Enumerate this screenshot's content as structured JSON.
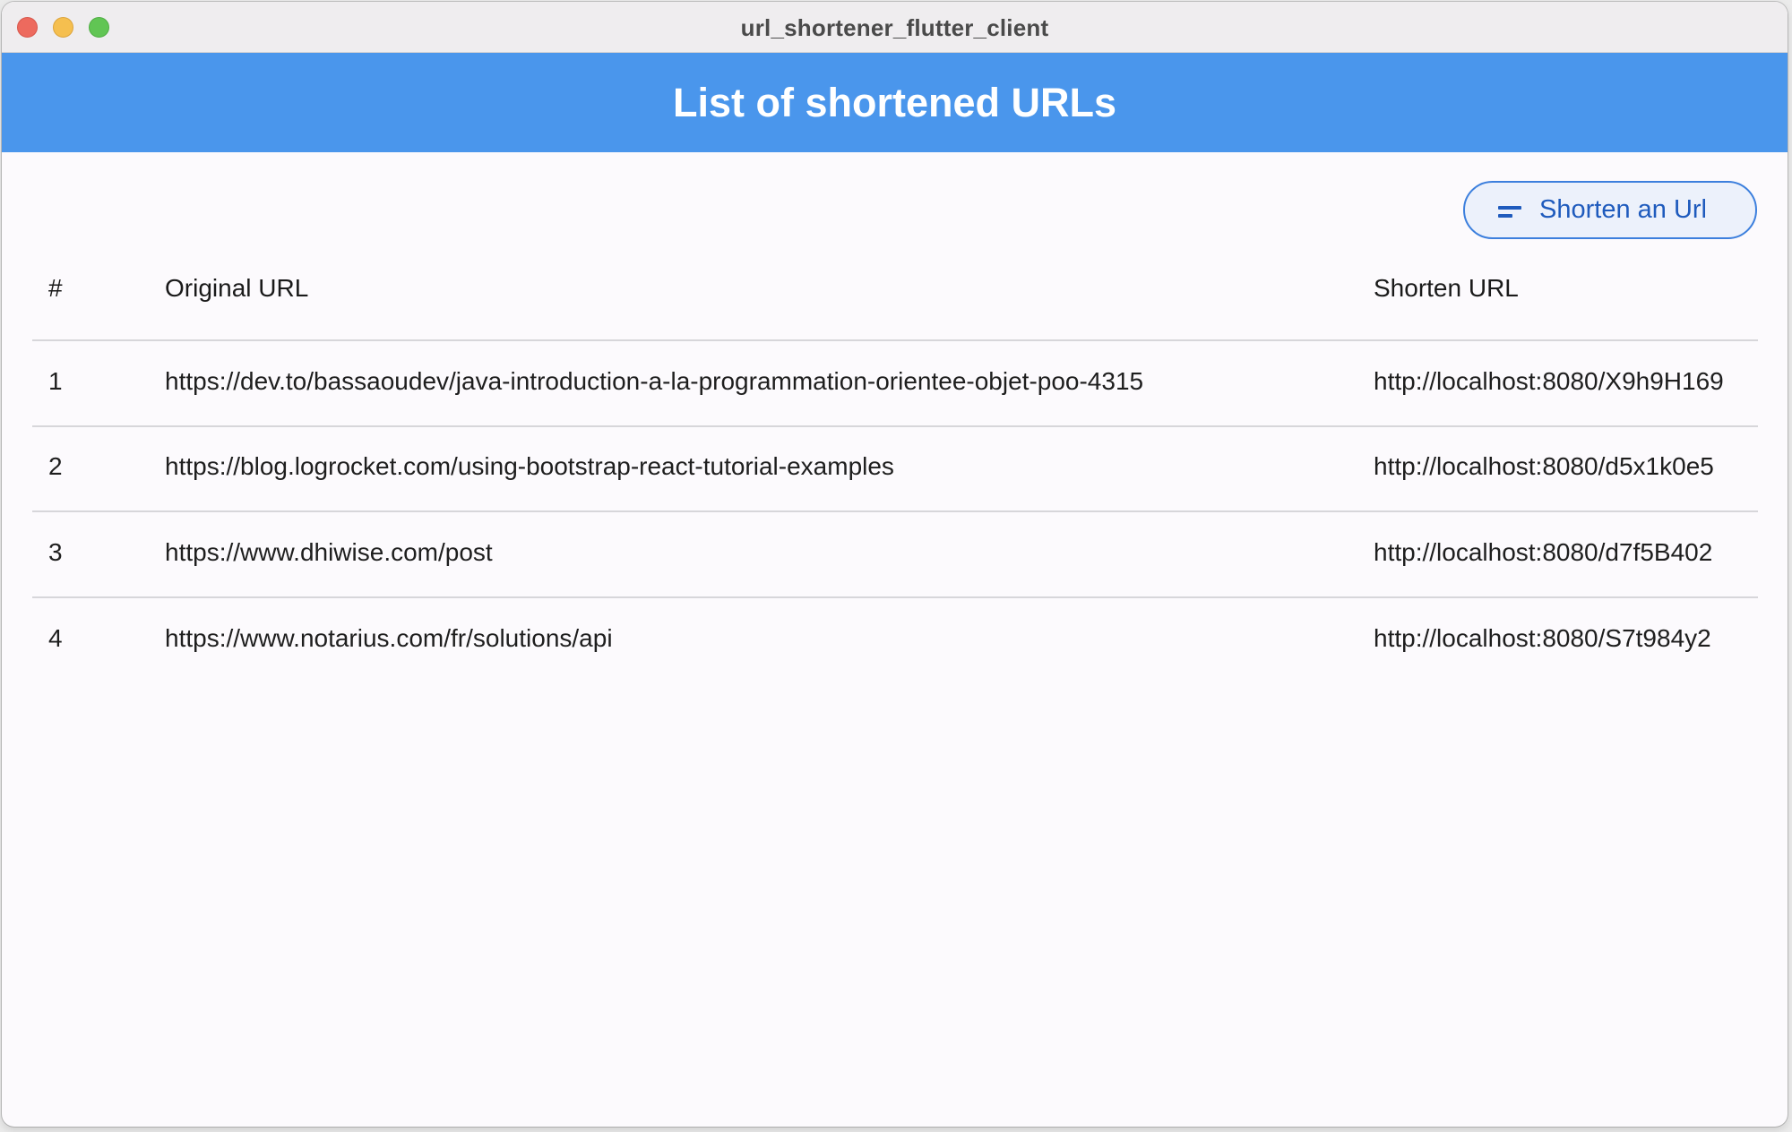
{
  "window": {
    "title": "url_shortener_flutter_client"
  },
  "appbar": {
    "title": "List of shortened URLs"
  },
  "toolbar": {
    "shorten_button_label": "Shorten an Url",
    "shorten_button_icon": "short-text-icon"
  },
  "table": {
    "headers": {
      "number": "#",
      "original": "Original URL",
      "shorten": "Shorten URL"
    },
    "rows": [
      {
        "number": "1",
        "original": "https://dev.to/bassaoudev/java-introduction-a-la-programmation-orientee-objet-poo-4315",
        "shorten": "http://localhost:8080/X9h9H169"
      },
      {
        "number": "2",
        "original": "https://blog.logrocket.com/using-bootstrap-react-tutorial-examples",
        "shorten": "http://localhost:8080/d5x1k0e5"
      },
      {
        "number": "3",
        "original": "https://www.dhiwise.com/post",
        "shorten": "http://localhost:8080/d7f5B402"
      },
      {
        "number": "4",
        "original": "https://www.notarius.com/fr/solutions/api",
        "shorten": "http://localhost:8080/S7t984y2"
      }
    ]
  },
  "colors": {
    "appbar": "#4a96ec",
    "button_text": "#1f5bbd",
    "button_border": "#3c7fdd",
    "background": "#fcfafd"
  }
}
